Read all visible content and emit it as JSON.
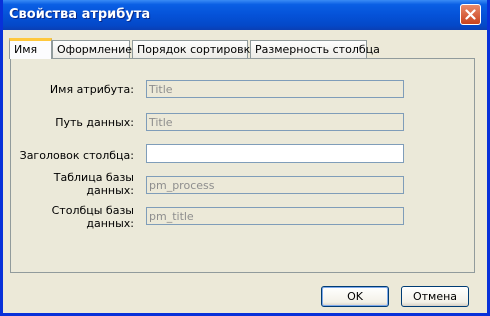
{
  "window": {
    "title": "Свойства атрибута"
  },
  "tabs": [
    {
      "label": "Имя",
      "active": true
    },
    {
      "label": "Оформление",
      "active": false
    },
    {
      "label": "Порядок сортировки",
      "active": false
    },
    {
      "label": "Размерность столбца",
      "active": false
    }
  ],
  "form": {
    "attr_name": {
      "label": "Имя атрибута:",
      "value": "Title"
    },
    "data_path": {
      "label": "Путь данных:",
      "value": "Title"
    },
    "column_header": {
      "label": "Заголовок столбца:",
      "value": ""
    },
    "db_table": {
      "label_line1": "Таблица базы",
      "label_line2": "данных:",
      "value": "pm_process"
    },
    "db_columns": {
      "label_line1": "Столбцы базы",
      "label_line2": "данных:",
      "value": "pm_title"
    }
  },
  "buttons": {
    "ok": "OK",
    "cancel": "Отмена"
  },
  "colors": {
    "titlebar": "#0552d8",
    "close": "#c9421d",
    "active_tab_accent": "#ffc83c"
  },
  "icons": {
    "close": "close-icon"
  }
}
